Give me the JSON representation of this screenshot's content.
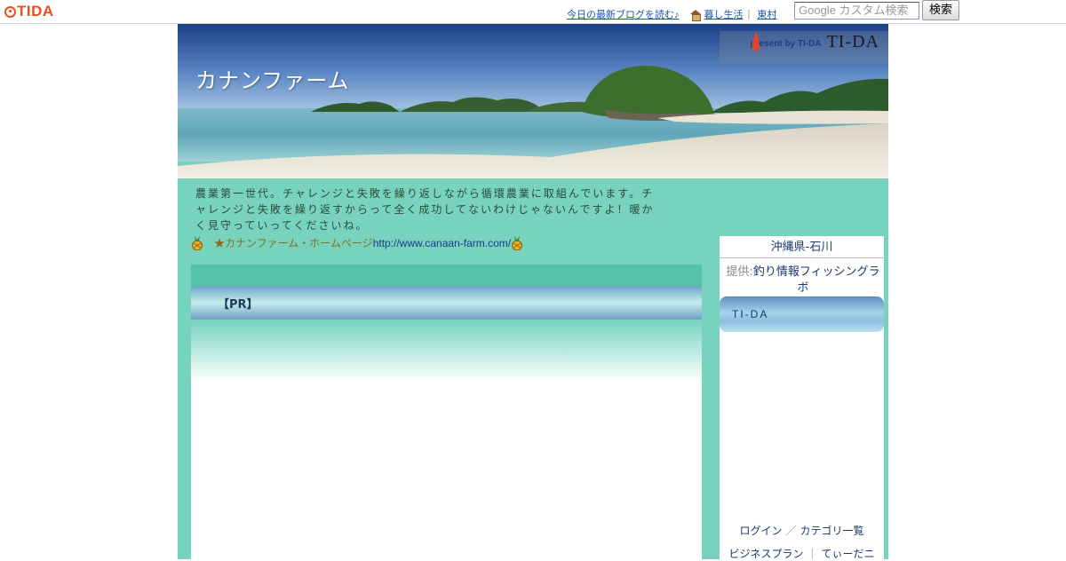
{
  "topbar": {
    "logo": "TIDA",
    "link_today": "今日の最新ブログを読む♪",
    "link_kurashi": "暮し生活",
    "link_higashi": "東村",
    "search_placeholder": "Google カスタム検索",
    "search_button": "検索"
  },
  "header": {
    "blog_title": "カナンファーム",
    "present_by": "present by TI-DA",
    "present_logo": "TI-DA"
  },
  "description": "農業第一世代。チャレンジと失敗を繰り返しながら循環農業に取組んでいます。チャレンジと失敗を繰り返すからって全く成功してないわけじゃないんですよ！暖かく見守っていってくださいね。",
  "homepage": {
    "label": "★カナンファーム・ホームページ",
    "url": "http://www.canaan-farm.com/"
  },
  "pr": {
    "label": "【PR】"
  },
  "sidebar": {
    "location": "沖縄県-石川",
    "provider_label": "提供:",
    "provider_name": "釣り情報フィッシングラボ",
    "tida_banner": "TI-DA",
    "login": "ログイン",
    "category_list": "カテゴリ一覧",
    "business_plan": "ビジネスプラン",
    "tiidani": "てぃーだニ"
  },
  "colors": {
    "page_background": "#77d3be",
    "logo": "#e8501e",
    "link": "#1a55a8"
  }
}
